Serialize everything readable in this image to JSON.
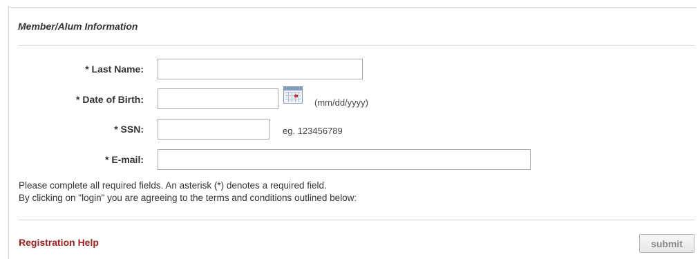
{
  "section": {
    "title": "Member/Alum Information"
  },
  "fields": {
    "last_name": {
      "label": "* Last Name:",
      "value": ""
    },
    "dob": {
      "label": "* Date of Birth:",
      "value": "",
      "hint": "(mm/dd/yyyy)"
    },
    "ssn": {
      "label": "* SSN:",
      "value": "",
      "hint": "eg. 123456789"
    },
    "email": {
      "label": "* E-mail:",
      "value": ""
    }
  },
  "notes": {
    "line1": "Please complete all required fields. An asterisk (*) denotes a required field.",
    "line2": "By clicking on \"login\" you are agreeing to the terms and conditions outlined below:"
  },
  "footer": {
    "help_label": "Registration Help",
    "submit_label": "submit"
  },
  "icons": {
    "date_picker": "calendar-icon"
  },
  "colors": {
    "link": "#a31f1f",
    "border": "#a9a9a9",
    "divider": "#d4d4d4"
  }
}
